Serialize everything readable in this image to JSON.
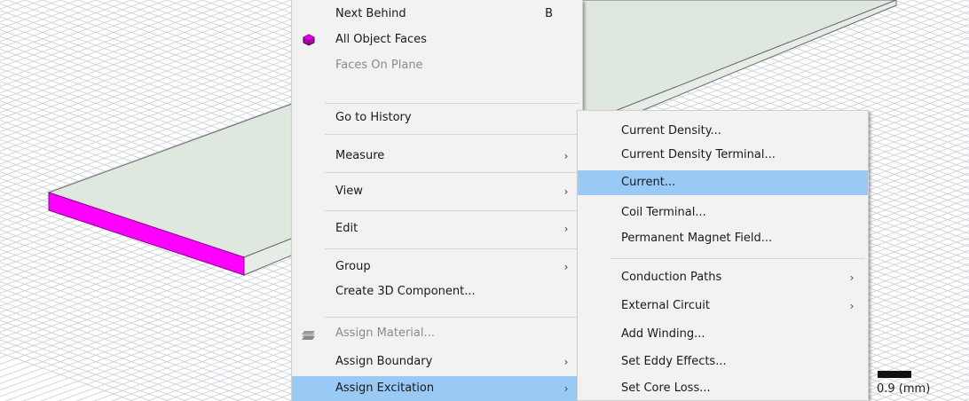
{
  "colors": {
    "grid_line": "#c8ced6",
    "plate_top": "#dfe8df",
    "plate_edge": "#6b6b6b",
    "selected_face": "#ff00ff",
    "highlight": "#99c9f5",
    "menu_bg": "#f2f2f2"
  },
  "context_menu": {
    "items": [
      {
        "label": "Next Behind",
        "shortcut": "B"
      },
      {
        "label": "All Object Faces",
        "icon": "object-faces-icon"
      },
      {
        "label": "Faces On Plane",
        "disabled": true
      },
      {
        "label": "Go to History"
      },
      {
        "label": "Measure"
      },
      {
        "label": "View"
      },
      {
        "label": "Edit"
      },
      {
        "label": "Group"
      },
      {
        "label": "Create 3D Component..."
      },
      {
        "label": "Assign Material...",
        "disabled": true,
        "icon": "material-icon"
      },
      {
        "label": "Assign Boundary"
      },
      {
        "label": "Assign Excitation",
        "highlighted": true
      }
    ],
    "arrow_glyph": "›"
  },
  "excitation_submenu": {
    "items": [
      {
        "label": "Current Density..."
      },
      {
        "label": "Current Density Terminal..."
      },
      {
        "label": "Current...",
        "highlighted": true
      },
      {
        "label": "Coil Terminal..."
      },
      {
        "label": "Permanent Magnet Field..."
      },
      {
        "label": "Conduction Paths"
      },
      {
        "label": "External Circuit"
      },
      {
        "label": "Add Winding..."
      },
      {
        "label": "Set Eddy Effects..."
      },
      {
        "label": "Set Core Loss..."
      }
    ]
  },
  "ruler": {
    "label": "0.9 (mm)"
  }
}
